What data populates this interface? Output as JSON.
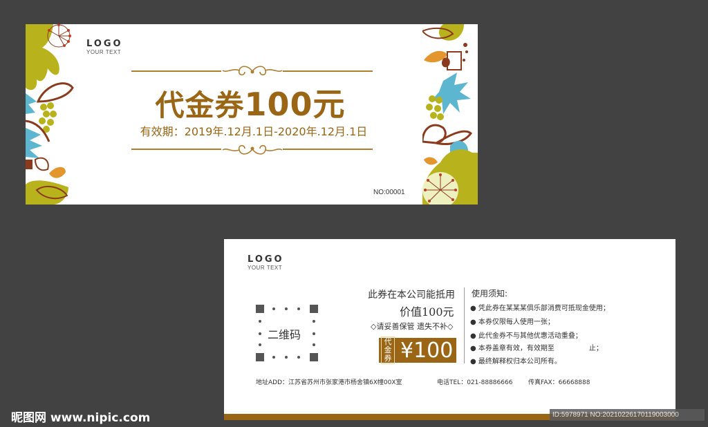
{
  "front": {
    "logo": "LOGO",
    "logo_sub": "YOUR TEXT",
    "title_prefix": "代金券",
    "title_amount": "100元",
    "validity": "有效期：2019年.12月.1日-2020年.12月.1日",
    "serial": "NO:00001"
  },
  "back": {
    "logo": "LOGO",
    "logo_sub": "YOUR TEXT",
    "qr_label": "二维码",
    "line1": "此券在本公司能抵用",
    "line2": "价值100元",
    "line3": "◇请妥善保管 遗失不补◇",
    "tag_label": "代金券",
    "tag_value": "¥100",
    "rules_title": "使用须知:",
    "rules": [
      "● 凭此券在某某某俱乐部消费可抵现金使用；",
      "● 本券仅限每人使用一张；",
      "● 此代金券不与其他优惠活动重叠；",
      "● 本券盖章有效，有效期至　　　　　止；",
      "● 最终解释权归本公司所有。"
    ],
    "address": "地址ADD：江苏省苏州市张家港市杨舍镇6X幢00X室",
    "phone": "电话TEL：021-88886666",
    "fax": "传真FAX：66668888"
  },
  "watermark": "昵图网 www.nipic.com",
  "image_id": "ID:5978971 NO:20210226170119003000",
  "colors": {
    "background": "#424242",
    "gold": "#9a6514",
    "olive": "#b8b21c",
    "teal": "#5cb6cf",
    "brown": "#8b3a1e",
    "orange": "#e4962e"
  }
}
